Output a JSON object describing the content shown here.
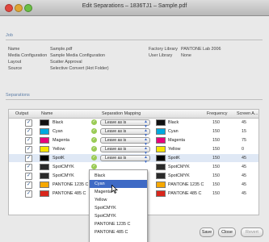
{
  "window": {
    "title": "Edit Separations – 1836TJ1 – Sample.pdf"
  },
  "colors": {
    "cyan": "#00a8e0",
    "magenta": "#e8007a",
    "yellow": "#f7e300",
    "black": "#111111",
    "spotk": "#000000",
    "spotcmyk": "#2a2a2a",
    "pantone1235": "#f6a800",
    "pantone485": "#d9261c"
  },
  "job": {
    "section": "Job",
    "name_label": "Name",
    "name_value": "Sample.pdf",
    "media_label": "Media Configuration",
    "media_value": "Sample Media Configuration",
    "layout_label": "Layout",
    "layout_value": "Scatter Approval",
    "source_label": "Source",
    "source_value": "Selective Convert (Hot Folder)",
    "factory_label": "Factory Library",
    "factory_value": "PANTONE Lab 2006",
    "user_label": "User Library",
    "user_value": "None"
  },
  "separations": {
    "section": "Separations",
    "headers": {
      "output": "Output",
      "name": "Name",
      "mapping": "Separation Mapping",
      "frequency": "Frequency",
      "screen": "Screen A..."
    },
    "rows": [
      {
        "name": "Black",
        "mapping": "Leave as is",
        "mapped": "Black",
        "frequency": "150",
        "angle": "45"
      },
      {
        "name": "Cyan",
        "mapping": "Leave as is",
        "mapped": "Cyan",
        "frequency": "150",
        "angle": "15"
      },
      {
        "name": "Magenta",
        "mapping": "Leave as is",
        "mapped": "Magenta",
        "frequency": "150",
        "angle": "75"
      },
      {
        "name": "Yellow",
        "mapping": "Leave as is",
        "mapped": "Yellow",
        "frequency": "150",
        "angle": "0"
      },
      {
        "name": "SpotK",
        "mapping": "Leave as is",
        "mapped": "SpotK",
        "frequency": "150",
        "angle": "45"
      },
      {
        "name": "SpotCMYK",
        "mapped": "SpotCMYK",
        "frequency": "150",
        "angle": "45"
      },
      {
        "name": "SpotCMYK",
        "mapped": "SpotCMYK",
        "frequency": "150",
        "angle": "45"
      },
      {
        "name": "PANTONE 1235 C",
        "mapped": "PANTONE 1235 C",
        "frequency": "150",
        "angle": "45"
      },
      {
        "name": "PANTONE 485 C",
        "mapped": "PANTONE 485 C",
        "frequency": "150",
        "angle": "45"
      }
    ]
  },
  "dropdown_menu": [
    "Black",
    "Cyan",
    "Magenta",
    "Yellow",
    "SpotCMYK",
    "SpotCMYK",
    "PANTONE 1235 C",
    "PANTONE 485 C"
  ],
  "buttons": {
    "save": "Save",
    "close": "Close",
    "revert": "Revert"
  }
}
